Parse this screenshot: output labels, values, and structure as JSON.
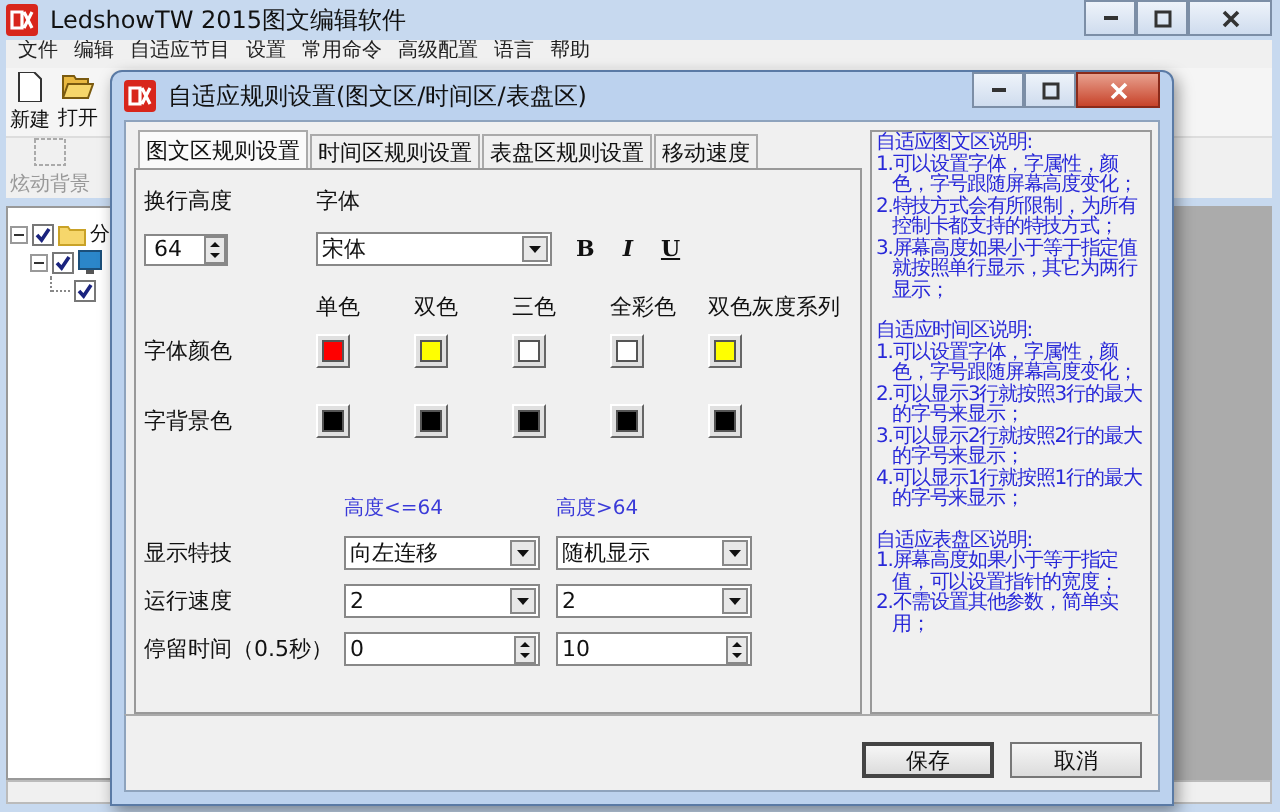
{
  "main_window": {
    "title": "LedshowTW 2015图文编辑软件",
    "menu": [
      "文件",
      "编辑",
      "自适应节目",
      "设置",
      "常用命令",
      "高级配置",
      "语言",
      "帮助"
    ],
    "toolbar": [
      {
        "label": "新建",
        "kind": "new"
      },
      {
        "label": "打开",
        "kind": "open"
      }
    ],
    "toolbar_2": [
      {
        "label": "炫动背景",
        "disabled": true
      }
    ],
    "tree": [
      {
        "label": "分",
        "kind": "folder",
        "checked": true,
        "expanded": true,
        "children": [
          {
            "kind": "screen",
            "checked": true,
            "expanded": true,
            "children": [
              {
                "checked": true
              }
            ]
          }
        ]
      }
    ]
  },
  "dialog": {
    "title": "自适应规则设置(图文区/时间区/表盘区)",
    "tabs": [
      {
        "label": "图文区规则设置",
        "selected": true
      },
      {
        "label": "时间区规则设置",
        "selected": false
      },
      {
        "label": "表盘区规则设置",
        "selected": false
      },
      {
        "label": "移动速度",
        "selected": false
      }
    ],
    "line_height": {
      "label": "换行高度",
      "value": "64"
    },
    "font": {
      "label": "字体",
      "value": "宋体"
    },
    "format_buttons": [
      {
        "label": "B",
        "kind": "bold"
      },
      {
        "label": "I",
        "kind": "italic"
      },
      {
        "label": "U",
        "kind": "underline"
      }
    ],
    "color_columns": [
      "单色",
      "双色",
      "三色",
      "全彩色",
      "双色灰度系列"
    ],
    "color_rows": [
      {
        "label": "字体颜色",
        "swatches": [
          {
            "color": "#ff0000"
          },
          {
            "color": "#ffff00"
          },
          {
            "color": "#ffffff"
          },
          {
            "color": "#ffffff"
          },
          {
            "color": "#ffff00"
          }
        ]
      },
      {
        "label": "字背景色",
        "swatches": [
          {
            "color": "#000000"
          },
          {
            "color": "#000000"
          },
          {
            "color": "#000000"
          },
          {
            "color": "#000000"
          },
          {
            "color": "#000000"
          }
        ]
      }
    ],
    "height_columns": [
      "高度<=64",
      "高度>64"
    ],
    "setting_rows": [
      {
        "label": "显示特技",
        "kind": "dropdown",
        "values": [
          "向左连移",
          "随机显示"
        ]
      },
      {
        "label": "运行速度",
        "kind": "dropdown",
        "values": [
          "2",
          "2"
        ]
      },
      {
        "label": "停留时间（0.5秒）",
        "kind": "spinner",
        "values": [
          "0",
          "10"
        ]
      }
    ],
    "notes": [
      {
        "title": "自适应图文区说明:",
        "items": [
          "1.可以设置字体，字属性，颜色，字号跟随屏幕高度变化；",
          "2.特技方式会有所限制，为所有控制卡都支持的特技方式；",
          "3.屏幕高度如果小于等于指定值就按照单行显示，其它为两行显示；"
        ]
      },
      {
        "title": "自适应时间区说明:",
        "items": [
          "1.可以设置字体，字属性，颜色，字号跟随屏幕高度变化；",
          "2.可以显示3行就按照3行的最大的字号来显示；",
          "3.可以显示2行就按照2行的最大的字号来显示；",
          "4.可以显示1行就按照1行的最大的字号来显示；"
        ]
      },
      {
        "title": "自适应表盘区说明:",
        "items": [
          "1.屏幕高度如果小于等于指定值，可以设置指针的宽度；",
          "2.不需设置其他参数，简单实用；"
        ]
      }
    ],
    "buttons": [
      "保存",
      "取消"
    ]
  }
}
